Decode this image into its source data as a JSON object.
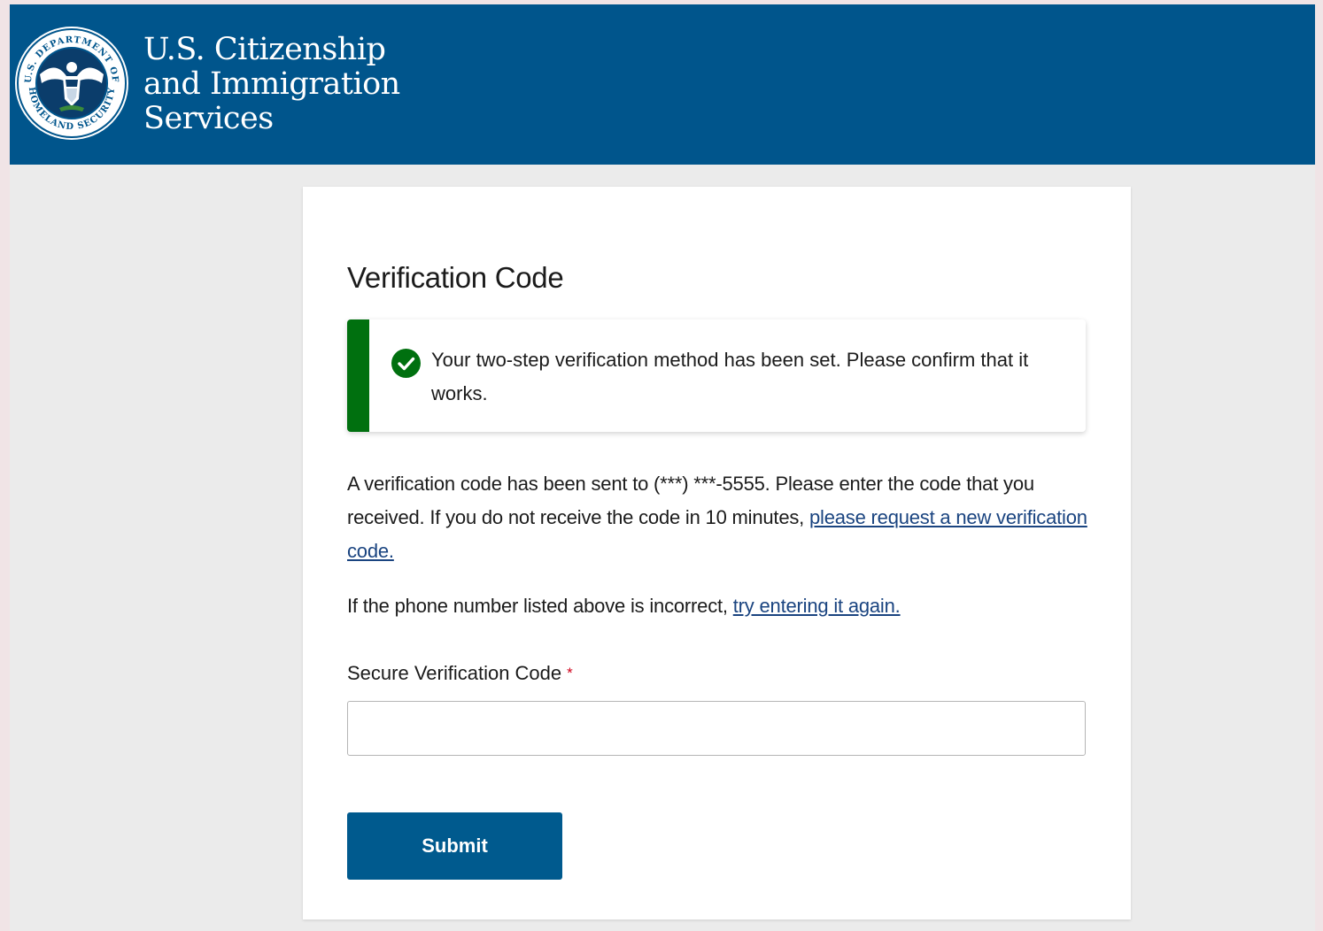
{
  "header": {
    "agency_name_line1": "U.S. Citizenship",
    "agency_name_line2": "and Immigration",
    "agency_name_line3": "Services",
    "seal_top_text": "U.S. DEPARTMENT OF",
    "seal_bottom_text": "HOMELAND SECURITY",
    "background_color": "#00558c"
  },
  "card": {
    "title": "Verification Code",
    "alert": {
      "icon": "check-circle-icon",
      "status_color": "#00700f",
      "message": "Your two-step verification method has been set. Please confirm that it works."
    },
    "instructions": {
      "text_before_link": "A verification code has been sent to (***) ***-5555. Please enter the code that you received. If you do not receive the code in 10 minutes, ",
      "link_text": "please request a new verification code."
    },
    "retry": {
      "text_before_link": "If the phone number listed above is incorrect, ",
      "link_text": "try entering it again."
    },
    "code_field": {
      "label": "Secure Verification Code",
      "required_marker": "*",
      "value": "",
      "placeholder": ""
    },
    "submit_label": "Submit"
  }
}
